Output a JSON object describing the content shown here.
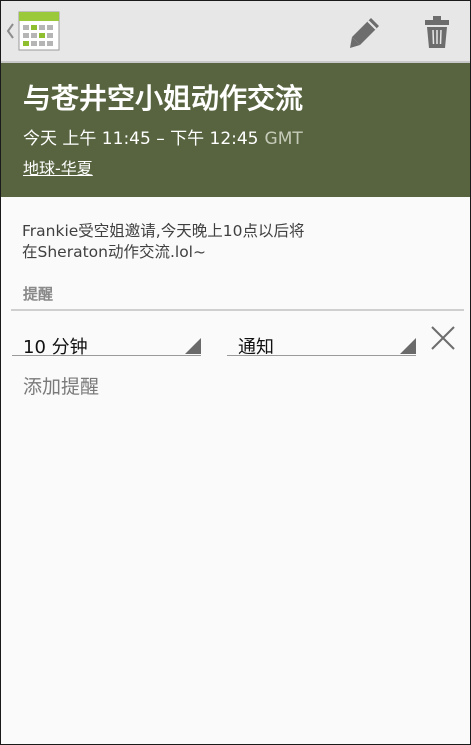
{
  "actionbar": {
    "app_icon": "calendar-icon",
    "up_icon": "chevron-left-icon",
    "edit_icon": "pencil-icon",
    "delete_icon": "trash-icon"
  },
  "event": {
    "title": "与苍井空小姐动作交流",
    "time_range": "今天 上午 11:45 – 下午 12:45",
    "timezone": "GMT",
    "location": "地球-华夏",
    "description_line1": "Frankie受空姐邀请,今天晚上10点以后将",
    "description_line2": "在Sheraton动作交流.lol~",
    "header_color": "#586440"
  },
  "reminders": {
    "label": "提醒",
    "minutes_value": "10 分钟",
    "method_value": "通知",
    "remove_icon": "close-icon",
    "add_label": "添加提醒"
  }
}
